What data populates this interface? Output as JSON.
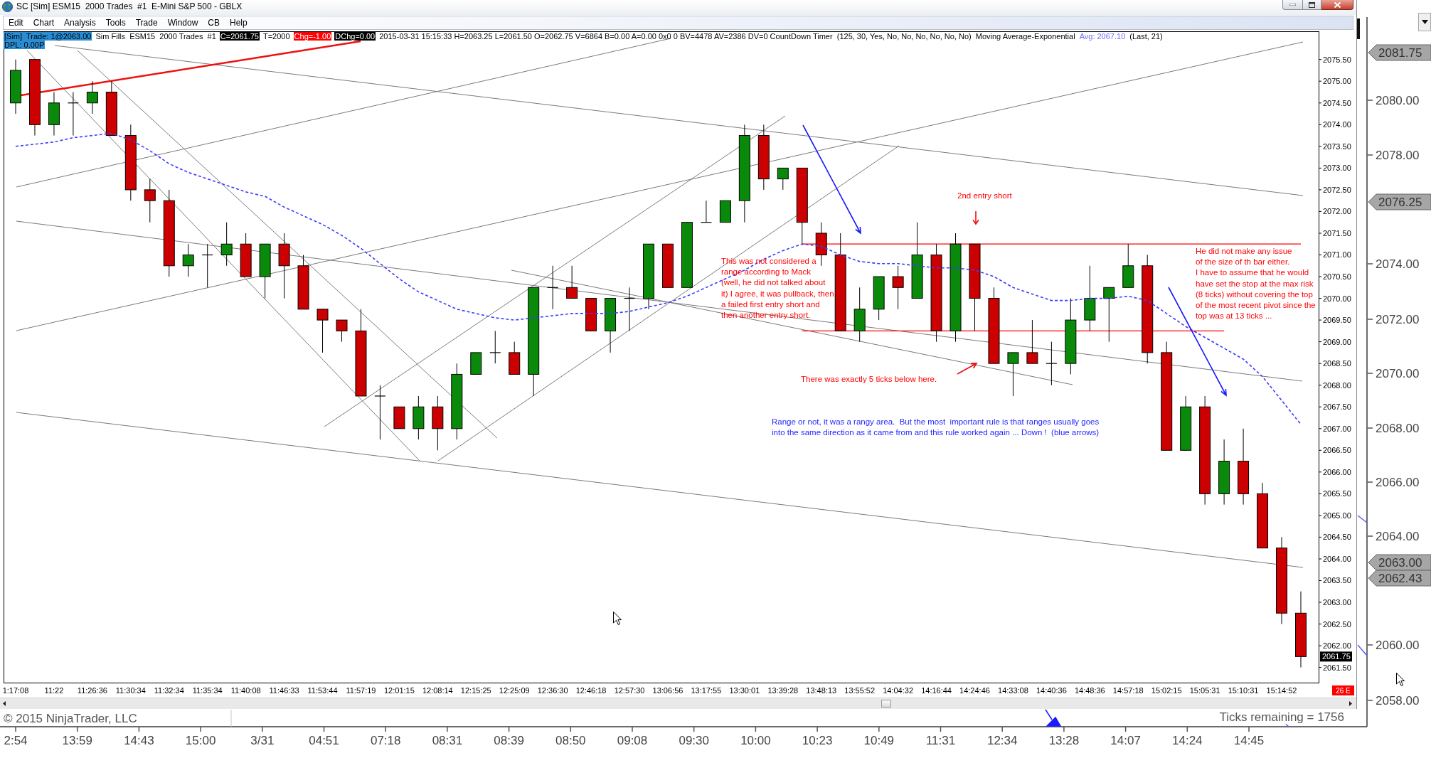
{
  "window": {
    "title": "SC [Sim] ESM15  2000 Trades  #1  E-Mini S&P 500 - GBLX"
  },
  "menu": [
    "Edit",
    "Chart",
    "Analysis",
    "Tools",
    "Trade",
    "Window",
    "CB",
    "Help"
  ],
  "info_bar": {
    "lines": [
      {
        "segments": [
          {
            "text": "[Sim]  Trade: 1@2063.00",
            "kind": "highlight"
          },
          {
            "text": "Sim Fills  ESM15  2000 Trades  #1",
            "kind": "plain"
          },
          {
            "text": "C=2061.75",
            "kind": "dark"
          },
          {
            "text": "T=2000",
            "kind": "plain"
          },
          {
            "text": "Chg=-1.00",
            "kind": "alert"
          },
          {
            "text": "DChg=0.00",
            "kind": "dark"
          },
          {
            "text": "2015-03-31 15:15:33 H=2063.25 L=2061.50 O=2062.75 V=6864 B=0.00 A=0.00 0x0 0 BV=4478 AV=2386 DV=0 CountDown Timer  (125, 30, Yes, No, No, No, No, No, No)  Moving Average-Exponential",
            "kind": "plain"
          },
          {
            "text": "Avg: 2067.10",
            "kind": "indicator"
          },
          {
            "text": "(Last, 21)",
            "kind": "plain"
          }
        ]
      },
      {
        "segments": [
          {
            "text": "DPL: 0.00P",
            "kind": "highlight"
          }
        ]
      }
    ]
  },
  "chart": {
    "chart_data": [
      {
        "type": "candlestick",
        "categories": [
          "1:17:08",
          null,
          "11:22",
          null,
          "11:26:36",
          null,
          "11:30:34",
          null,
          "11:32:34",
          null,
          "11:35:34",
          null,
          "11:40:08",
          null,
          "11:46:33",
          null,
          "11:53:44",
          null,
          "11:57:19",
          null,
          "12:01:15",
          null,
          "12:08:14",
          null,
          "12:15:25",
          null,
          "12:25:09",
          null,
          "12:36:30",
          null,
          "12:46:18",
          null,
          "12:57:30",
          null,
          "13:06:56",
          null,
          "13:17:55",
          null,
          "13:30:01",
          null,
          "13:39:28",
          null,
          "13:48:13",
          null,
          "13:55:52",
          null,
          "14:04:32",
          null,
          "14:16:44",
          null,
          "14:24:46",
          null,
          "14:33:08",
          null,
          "14:40:36",
          null,
          "14:48:36",
          null,
          "14:57:18",
          null,
          "15:02:15",
          null,
          "15:05:31",
          null,
          "15:10:31",
          null,
          "15:14:52",
          null
        ],
        "ohlc": [
          [
            2074.5,
            2075.5,
            2074.25,
            2075.25
          ],
          [
            2075.5,
            2075.5,
            2073.75,
            2074.0
          ],
          [
            2074.0,
            2074.75,
            2073.75,
            2074.5
          ],
          [
            2074.5,
            2074.75,
            2073.75,
            2074.5
          ],
          [
            2074.5,
            2075.0,
            2074.25,
            2074.75
          ],
          [
            2074.75,
            2075.0,
            2073.75,
            2073.75
          ],
          [
            2073.75,
            2074.0,
            2072.25,
            2072.5
          ],
          [
            2072.5,
            2072.75,
            2071.75,
            2072.25
          ],
          [
            2072.25,
            2072.5,
            2070.5,
            2070.75
          ],
          [
            2070.75,
            2071.25,
            2070.5,
            2071.0
          ],
          [
            2071.0,
            2071.25,
            2070.25,
            2071.0
          ],
          [
            2071.0,
            2071.75,
            2070.75,
            2071.25
          ],
          [
            2071.25,
            2071.5,
            2070.5,
            2070.5
          ],
          [
            2070.5,
            2071.25,
            2070.0,
            2071.25
          ],
          [
            2071.25,
            2071.5,
            2070.0,
            2070.75
          ],
          [
            2070.75,
            2071.0,
            2069.75,
            2069.75
          ],
          [
            2069.75,
            2069.75,
            2068.75,
            2069.5
          ],
          [
            2069.5,
            2069.5,
            2069.0,
            2069.25
          ],
          [
            2069.25,
            2069.75,
            2067.75,
            2067.75
          ],
          [
            2067.75,
            2068.0,
            2066.75,
            2067.75
          ],
          [
            2067.5,
            2067.5,
            2067.0,
            2067.0
          ],
          [
            2067.0,
            2067.75,
            2066.75,
            2067.5
          ],
          [
            2067.5,
            2067.75,
            2066.5,
            2067.0
          ],
          [
            2067.0,
            2068.5,
            2066.75,
            2068.25
          ],
          [
            2068.25,
            2068.75,
            2068.25,
            2068.75
          ],
          [
            2068.75,
            2069.25,
            2068.5,
            2068.75
          ],
          [
            2068.75,
            2069.0,
            2068.25,
            2068.25
          ],
          [
            2068.25,
            2070.25,
            2067.75,
            2070.25
          ],
          [
            2070.25,
            2070.75,
            2069.75,
            2070.25
          ],
          [
            2070.25,
            2070.75,
            2070.0,
            2070.0
          ],
          [
            2070.0,
            2070.0,
            2069.25,
            2069.25
          ],
          [
            2069.25,
            2070.0,
            2068.75,
            2070.0
          ],
          [
            2070.0,
            2070.25,
            2069.25,
            2070.0
          ],
          [
            2070.0,
            2071.25,
            2069.75,
            2071.25
          ],
          [
            2071.25,
            2071.25,
            2070.25,
            2070.25
          ],
          [
            2070.25,
            2071.75,
            2070.25,
            2071.75
          ],
          [
            2071.75,
            2072.25,
            2071.75,
            2071.75
          ],
          [
            2071.75,
            2072.25,
            2071.75,
            2072.25
          ],
          [
            2072.25,
            2074.0,
            2071.75,
            2073.75
          ],
          [
            2073.75,
            2074.0,
            2072.5,
            2072.75
          ],
          [
            2072.75,
            2073.0,
            2072.5,
            2073.0
          ],
          [
            2073.0,
            2073.0,
            2071.25,
            2071.75
          ],
          [
            2071.5,
            2071.75,
            2070.75,
            2071.0
          ],
          [
            2071.0,
            2071.5,
            2069.25,
            2069.25
          ],
          [
            2069.25,
            2070.25,
            2069.0,
            2069.75
          ],
          [
            2069.75,
            2070.5,
            2069.5,
            2070.5
          ],
          [
            2070.5,
            2070.75,
            2069.75,
            2070.25
          ],
          [
            2070.0,
            2071.75,
            2070.0,
            2071.0
          ],
          [
            2071.0,
            2071.25,
            2069.0,
            2069.25
          ],
          [
            2069.25,
            2071.5,
            2069.0,
            2071.25
          ],
          [
            2071.25,
            2071.25,
            2069.25,
            2070.0
          ],
          [
            2070.0,
            2070.25,
            2068.5,
            2068.5
          ],
          [
            2068.5,
            2068.75,
            2067.75,
            2068.75
          ],
          [
            2068.75,
            2069.5,
            2068.5,
            2068.5
          ],
          [
            2068.5,
            2069.0,
            2068.0,
            2068.5
          ],
          [
            2068.5,
            2070.0,
            2068.25,
            2069.5
          ],
          [
            2069.5,
            2070.75,
            2069.25,
            2070.0
          ],
          [
            2070.0,
            2070.25,
            2069.0,
            2070.25
          ],
          [
            2070.25,
            2071.25,
            2070.25,
            2070.75
          ],
          [
            2070.75,
            2071.0,
            2068.5,
            2068.75
          ],
          [
            2068.75,
            2069.0,
            2066.5,
            2066.5
          ],
          [
            2066.5,
            2067.75,
            2066.5,
            2067.5
          ],
          [
            2067.5,
            2067.75,
            2065.25,
            2065.5
          ],
          [
            2065.5,
            2066.75,
            2065.25,
            2066.25
          ],
          [
            2066.25,
            2067.0,
            2065.25,
            2065.5
          ],
          [
            2065.5,
            2065.75,
            2064.25,
            2064.25
          ],
          [
            2064.25,
            2064.5,
            2062.5,
            2062.75
          ],
          [
            2062.75,
            2063.25,
            2061.5,
            2061.75
          ]
        ],
        "series": [
          {
            "type": "line",
            "color": "#3c3cff",
            "line_style": "dashed",
            "values": [
              2073.5,
              2073.55,
              2073.6,
              2073.7,
              2073.75,
              2073.8,
              2073.65,
              2073.4,
              2073.1,
              2072.9,
              2072.75,
              2072.6,
              2072.45,
              2072.35,
              2072.1,
              2071.9,
              2071.7,
              2071.45,
              2071.15,
              2070.8,
              2070.45,
              2070.15,
              2069.95,
              2069.75,
              2069.65,
              2069.55,
              2069.5,
              2069.55,
              2069.6,
              2069.65,
              2069.65,
              2069.65,
              2069.7,
              2069.8,
              2069.9,
              2070.05,
              2070.25,
              2070.45,
              2070.65,
              2070.9,
              2071.1,
              2071.25,
              2071.2,
              2071.0,
              2070.85,
              2070.8,
              2070.8,
              2070.75,
              2070.7,
              2070.7,
              2070.65,
              2070.5,
              2070.25,
              2070.1,
              2069.95,
              2069.95,
              2070.0,
              2070.0,
              2070.05,
              2069.95,
              2069.65,
              2069.35,
              2069.1,
              2068.85,
              2068.6,
              2068.2,
              2067.65,
              2067.1
            ]
          }
        ],
        "ylim": [
          2061.15,
          2076.15
        ],
        "yticks": [
          {
            "value": 2075.5,
            "label": "2075.50"
          },
          {
            "value": 2075,
            "label": "2075.00"
          },
          {
            "value": 2074.5,
            "label": "2074.50"
          },
          {
            "value": 2074,
            "label": "2074.00"
          },
          {
            "value": 2073.5,
            "label": "2073.50"
          },
          {
            "value": 2073,
            "label": "2073.00"
          },
          {
            "value": 2072.5,
            "label": "2072.50"
          },
          {
            "value": 2072,
            "label": "2072.00"
          },
          {
            "value": 2071.5,
            "label": "2071.50"
          },
          {
            "value": 2071,
            "label": "2071.00"
          },
          {
            "value": 2070.5,
            "label": "2070.50"
          },
          {
            "value": 2070,
            "label": "2070.00"
          },
          {
            "value": 2069.5,
            "label": "2069.50"
          },
          {
            "value": 2069,
            "label": "2069.00"
          },
          {
            "value": 2068.5,
            "label": "2068.50"
          },
          {
            "value": 2068,
            "label": "2068.00"
          },
          {
            "value": 2067.5,
            "label": "2067.50"
          },
          {
            "value": 2067,
            "label": "2067.00"
          },
          {
            "value": 2066.5,
            "label": "2066.50"
          },
          {
            "value": 2066,
            "label": "2066.00"
          },
          {
            "value": 2065.5,
            "label": "2065.50"
          },
          {
            "value": 2065,
            "label": "2065.00"
          },
          {
            "value": 2064.5,
            "label": "2064.50"
          },
          {
            "value": 2064,
            "label": "2064.00"
          },
          {
            "value": 2063.5,
            "label": "2063.50"
          },
          {
            "value": 2063,
            "label": "2063.00"
          },
          {
            "value": 2062.5,
            "label": "2062.50"
          },
          {
            "value": 2062,
            "label": "2062.00"
          },
          {
            "value": 2061.5,
            "label": "2061.50"
          }
        ],
        "annotations": [
          "This was not considered a\nrange according to Mack\n(well, he did not talked about\nit) I agree, it was pullback, then\na failed first entry short and\nthen another entry short.",
          "2nd entry short",
          "There was exactly 5 ticks below here.",
          "Range or not, it was a rangy area.  But the most  important rule is that ranges usually goes\ninto the same direction as it came from and this rule worked again ... Down !  (blue arrows)",
          "He did not make any issue\nof the size of th bar either.\nI have to assume that he would\nhave set the stop at the max risk\n(8 ticks) without covering the top\nof the most recent pivot since the\ntop was at 13 ticks ..."
        ]
      }
    ],
    "last_price": "2061.75",
    "countdown": "26 E"
  },
  "background_chart": {
    "price_axis": [
      {
        "text": "2081.75",
        "kind": "tag"
      },
      {
        "text": "2080.00",
        "kind": "label"
      },
      {
        "text": "2078.00",
        "kind": "label"
      },
      {
        "text": "2076.25",
        "kind": "tag"
      },
      {
        "text": "2074.00",
        "kind": "label"
      },
      {
        "text": "2072.00",
        "kind": "label"
      },
      {
        "text": "2070.00",
        "kind": "label"
      },
      {
        "text": "2068.00",
        "kind": "label"
      },
      {
        "text": "2066.00",
        "kind": "label"
      },
      {
        "text": "2064.00",
        "kind": "label"
      },
      {
        "text": "2063.00",
        "kind": "tag"
      },
      {
        "text": "2062.43",
        "kind": "tag"
      },
      {
        "text": "2060.00",
        "kind": "label"
      },
      {
        "text": "2058.00",
        "kind": "label"
      }
    ],
    "time_axis": [
      "2:54",
      "13:59",
      "14:43",
      "15:00",
      "3/31",
      "04:51",
      "07:18",
      "08:31",
      "08:39",
      "08:50",
      "09:08",
      "09:30",
      "10:00",
      "10:23",
      "10:49",
      "11:31",
      "12:34",
      "13:28",
      "14:07",
      "14:24",
      "14:45"
    ],
    "copyright": "© 2015 NinjaTrader, LLC",
    "status": "Ticks remaining = 1756"
  }
}
